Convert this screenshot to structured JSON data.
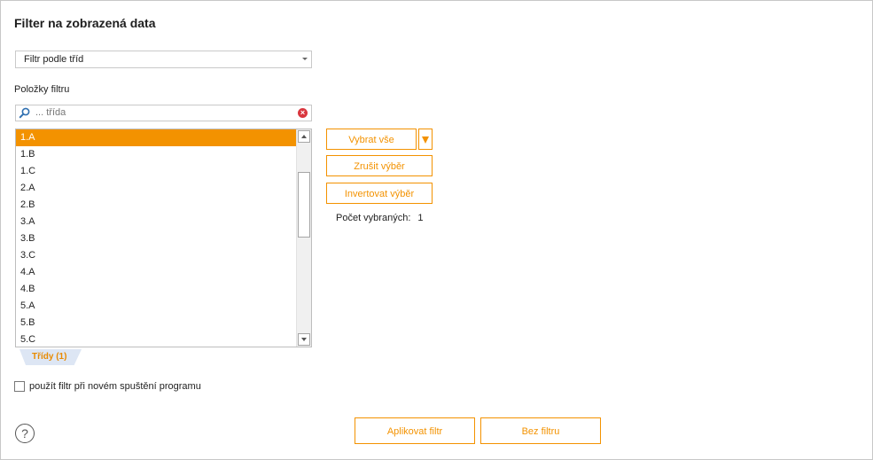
{
  "dialog": {
    "title": "Filter na zobrazená data"
  },
  "filter_type": {
    "selected": "Filtr podle tříd"
  },
  "items_section": {
    "label": "Položky filtru"
  },
  "search": {
    "placeholder": "... třída"
  },
  "list": {
    "items": [
      "1.A",
      "1.B",
      "1.C",
      "2.A",
      "2.B",
      "3.A",
      "3.B",
      "3.C",
      "4.A",
      "4.B",
      "5.A",
      "5.B",
      "5.C"
    ],
    "selected_index": 0
  },
  "tab": {
    "label": "Třídy (1)"
  },
  "actions": {
    "select_all": "Vybrat vše",
    "clear_selection": "Zrušit výběr",
    "invert_selection": "Invertovat výběr"
  },
  "count": {
    "label": "Počet vybraných:",
    "value": "1"
  },
  "option": {
    "label": "použít filtr při novém spuštění programu",
    "checked": false
  },
  "footer": {
    "apply": "Aplikovat filtr",
    "no_filter": "Bez filtru",
    "help_symbol": "?"
  },
  "colors": {
    "accent": "#f39200",
    "tab_bg": "#dde6f4"
  }
}
